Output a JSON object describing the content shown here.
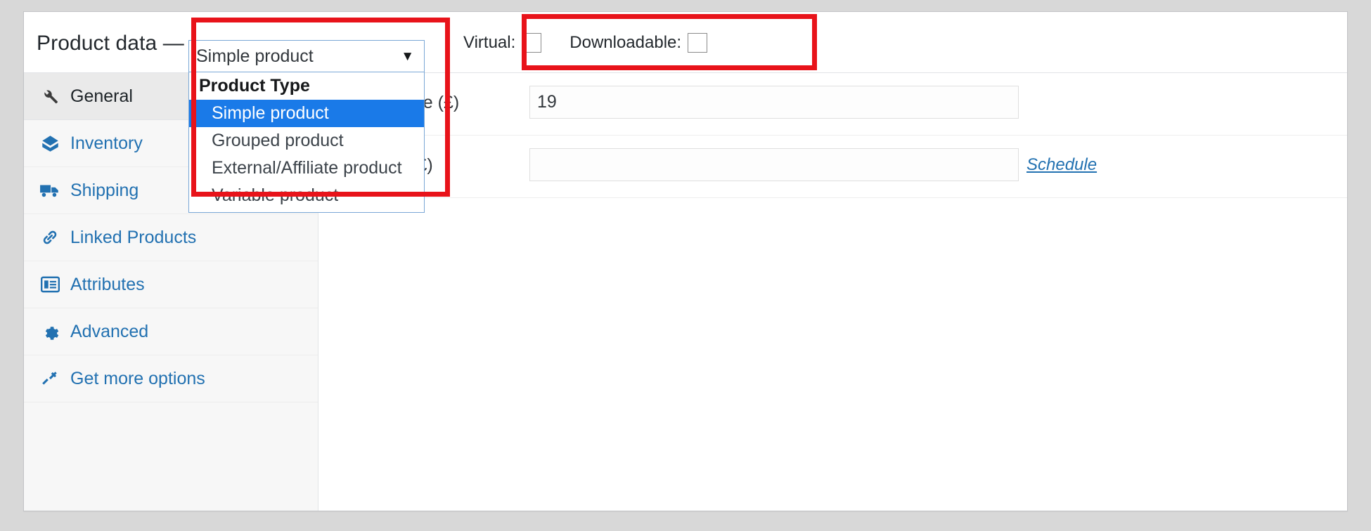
{
  "panel": {
    "title": "Product data —"
  },
  "product_type": {
    "selected": "Simple product",
    "caret_icon": "chevron-down-icon",
    "group_label": "Product Type",
    "options": [
      "Simple product",
      "Grouped product",
      "External/Affiliate product",
      "Variable product"
    ],
    "selected_index": 0
  },
  "flags": [
    {
      "label": "Virtual:",
      "checked": false
    },
    {
      "label": "Downloadable:",
      "checked": false
    }
  ],
  "tabs": [
    {
      "label": "General",
      "icon": "wrench-icon",
      "active": true
    },
    {
      "label": "Inventory",
      "icon": "archive-icon",
      "active": false
    },
    {
      "label": "Shipping",
      "icon": "truck-icon",
      "active": false
    },
    {
      "label": "Linked Products",
      "icon": "link-icon",
      "active": false
    },
    {
      "label": "Attributes",
      "icon": "list-icon",
      "active": false
    },
    {
      "label": "Advanced",
      "icon": "gear-icon",
      "active": false
    },
    {
      "label": "Get more options",
      "icon": "plugin-icon",
      "active": false
    }
  ],
  "fields": [
    {
      "label": "Regular price (£)",
      "value": "19",
      "placeholder": "",
      "link": ""
    },
    {
      "label": "Sale price (£)",
      "value": "",
      "placeholder": "",
      "link": "Schedule"
    }
  ],
  "colors": {
    "accent_blue": "#2271b1",
    "highlight_blue": "#1a7ae8",
    "annotation_red": "#e8131a",
    "panel_bg": "#ffffff",
    "rail_bg": "#f7f7f7",
    "page_bg": "#d8d8d8"
  }
}
